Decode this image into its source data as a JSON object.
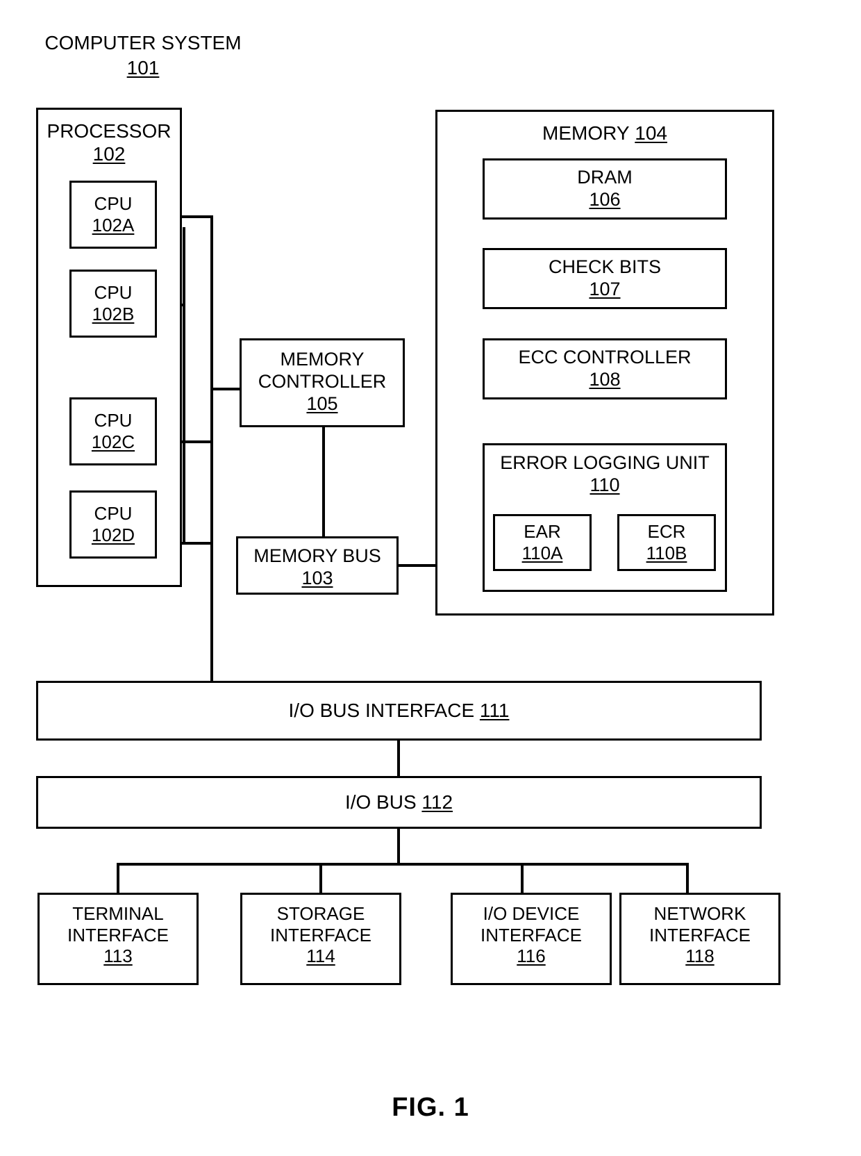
{
  "figure": {
    "caption": "FIG. 1",
    "system_title": "COMPUTER SYSTEM",
    "system_ref": "101"
  },
  "processor": {
    "label": "PROCESSOR",
    "ref": "102",
    "cpus": [
      {
        "label": "CPU",
        "ref": "102A"
      },
      {
        "label": "CPU",
        "ref": "102B"
      },
      {
        "label": "CPU",
        "ref": "102C"
      },
      {
        "label": "CPU",
        "ref": "102D"
      }
    ]
  },
  "memory_controller": {
    "line1": "MEMORY",
    "line2": "CONTROLLER",
    "ref": "105"
  },
  "memory_bus": {
    "label": "MEMORY BUS",
    "ref": "103"
  },
  "memory": {
    "label": "MEMORY",
    "ref": "104",
    "dram": {
      "label": "DRAM",
      "ref": "106"
    },
    "check_bits": {
      "label": "CHECK BITS",
      "ref": "107"
    },
    "ecc_controller": {
      "label": "ECC CONTROLLER",
      "ref": "108"
    },
    "error_logging_unit": {
      "label": "ERROR LOGGING UNIT",
      "ref": "110",
      "registers": [
        {
          "label": "EAR",
          "ref": "110A"
        },
        {
          "label": "ECR",
          "ref": "110B"
        }
      ]
    }
  },
  "io_bus_interface": {
    "label": "I/O BUS INTERFACE",
    "ref": "111"
  },
  "io_bus": {
    "label": "I/O BUS",
    "ref": "112"
  },
  "interfaces": [
    {
      "line1": "TERMINAL",
      "line2": "INTERFACE",
      "ref": "113"
    },
    {
      "line1": "STORAGE",
      "line2": "INTERFACE",
      "ref": "114"
    },
    {
      "line1": "I/O DEVICE",
      "line2": "INTERFACE",
      "ref": "116"
    },
    {
      "line1": "NETWORK",
      "line2": "INTERFACE",
      "ref": "118"
    }
  ],
  "style": {
    "stroke_color": "#000000",
    "background_color": "#ffffff"
  }
}
